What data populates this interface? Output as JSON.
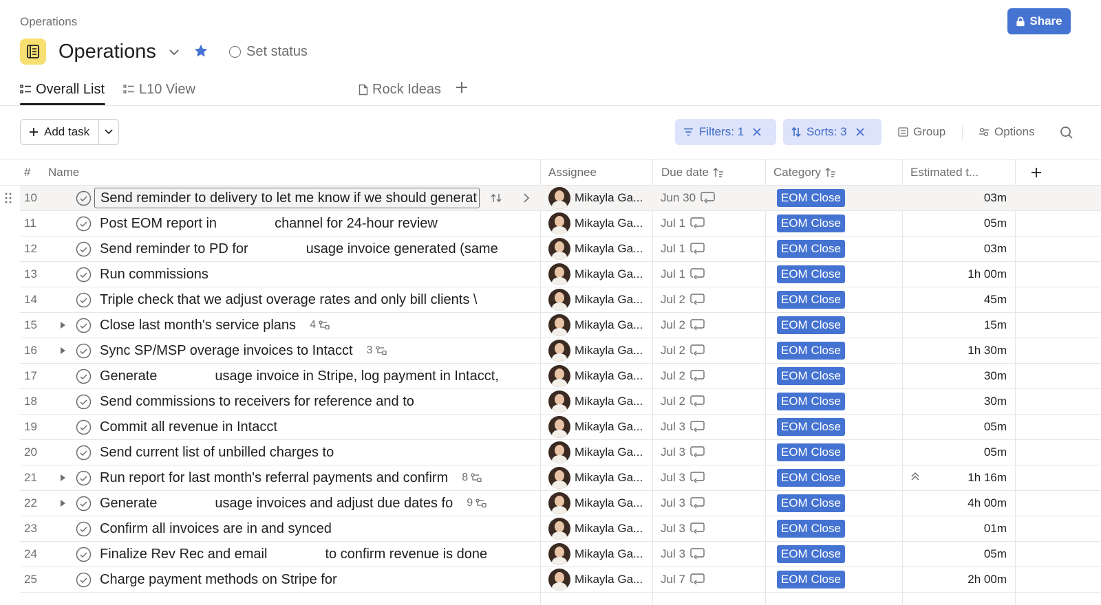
{
  "breadcrumb": "Operations",
  "share_label": "Share",
  "project": {
    "title": "Operations",
    "set_status": "Set status"
  },
  "tabs": [
    {
      "label": "Overall List"
    },
    {
      "label": "L10 View"
    },
    {
      "label": "Rock Ideas"
    }
  ],
  "toolbar": {
    "add_task": "Add task",
    "filters": "Filters: 1",
    "sorts": "Sorts: 3",
    "group": "Group",
    "options": "Options"
  },
  "columns": {
    "num": "#",
    "name": "Name",
    "assignee": "Assignee",
    "due": "Due date",
    "category": "Category",
    "estimated": "Estimated t..."
  },
  "rows": [
    {
      "num": "10",
      "name": "Send reminder to delivery to let me know if we should generat",
      "assignee": "Mikayla Ga...",
      "due": "Jun 30",
      "category": "EOM Close",
      "est": "03m"
    },
    {
      "num": "11",
      "name_a": "Post EOM report in",
      "name_b": "channel for 24-hour review",
      "assignee": "Mikayla Ga...",
      "due": "Jul 1",
      "category": "EOM Close",
      "est": "05m"
    },
    {
      "num": "12",
      "name_a": "Send reminder to PD for",
      "name_b": "usage invoice generated (same",
      "assignee": "Mikayla Ga...",
      "due": "Jul 1",
      "category": "EOM Close",
      "est": "03m"
    },
    {
      "num": "13",
      "name": "Run commissions",
      "assignee": "Mikayla Ga...",
      "due": "Jul 1",
      "category": "EOM Close",
      "est": "1h 00m"
    },
    {
      "num": "14",
      "name": "Triple check that we adjust overage rates and only bill clients \\",
      "assignee": "Mikayla Ga...",
      "due": "Jul 2",
      "category": "EOM Close",
      "est": "45m"
    },
    {
      "num": "15",
      "name": "Close last month's service plans",
      "subtasks": "4",
      "assignee": "Mikayla Ga...",
      "due": "Jul 2",
      "category": "EOM Close",
      "est": "15m"
    },
    {
      "num": "16",
      "name": "Sync SP/MSP overage invoices to Intacct",
      "subtasks": "3",
      "assignee": "Mikayla Ga...",
      "due": "Jul 2",
      "category": "EOM Close",
      "est": "1h 30m"
    },
    {
      "num": "17",
      "name_a": "Generate",
      "name_b": "usage invoice in Stripe, log payment in Intacct,",
      "assignee": "Mikayla Ga...",
      "due": "Jul 2",
      "category": "EOM Close",
      "est": "30m"
    },
    {
      "num": "18",
      "name": "Send commissions to receivers for reference and to",
      "assignee": "Mikayla Ga...",
      "due": "Jul 2",
      "category": "EOM Close",
      "est": "30m"
    },
    {
      "num": "19",
      "name": "Commit all revenue in Intacct",
      "assignee": "Mikayla Ga...",
      "due": "Jul 3",
      "category": "EOM Close",
      "est": "05m"
    },
    {
      "num": "20",
      "name": "Send current list of unbilled charges to",
      "assignee": "Mikayla Ga...",
      "due": "Jul 3",
      "category": "EOM Close",
      "est": "05m"
    },
    {
      "num": "21",
      "name": "Run report for last month's referral payments and confirm",
      "subtasks": "8",
      "assignee": "Mikayla Ga...",
      "due": "Jul 3",
      "category": "EOM Close",
      "est": "1h 16m"
    },
    {
      "num": "22",
      "name_a": "Generate",
      "name_b": "usage invoices and adjust due dates fo",
      "subtasks": "9",
      "assignee": "Mikayla Ga...",
      "due": "Jul 3",
      "category": "EOM Close",
      "est": "4h 00m"
    },
    {
      "num": "23",
      "name": "Confirm all invoices are in and synced",
      "assignee": "Mikayla Ga...",
      "due": "Jul 3",
      "category": "EOM Close",
      "est": "01m"
    },
    {
      "num": "24",
      "name_a": "Finalize Rev Rec and email",
      "name_b": "to confirm revenue is done",
      "assignee": "Mikayla Ga...",
      "due": "Jul 3",
      "category": "EOM Close",
      "est": "05m"
    },
    {
      "num": "25",
      "name": "Charge payment methods on Stripe for",
      "assignee": "Mikayla Ga...",
      "due": "Jul 7",
      "category": "EOM Close",
      "est": "2h 00m"
    }
  ],
  "colors": {
    "accent": "#4573d2",
    "chip_bg": "#dce3fb",
    "project_icon": "#f8df72"
  }
}
